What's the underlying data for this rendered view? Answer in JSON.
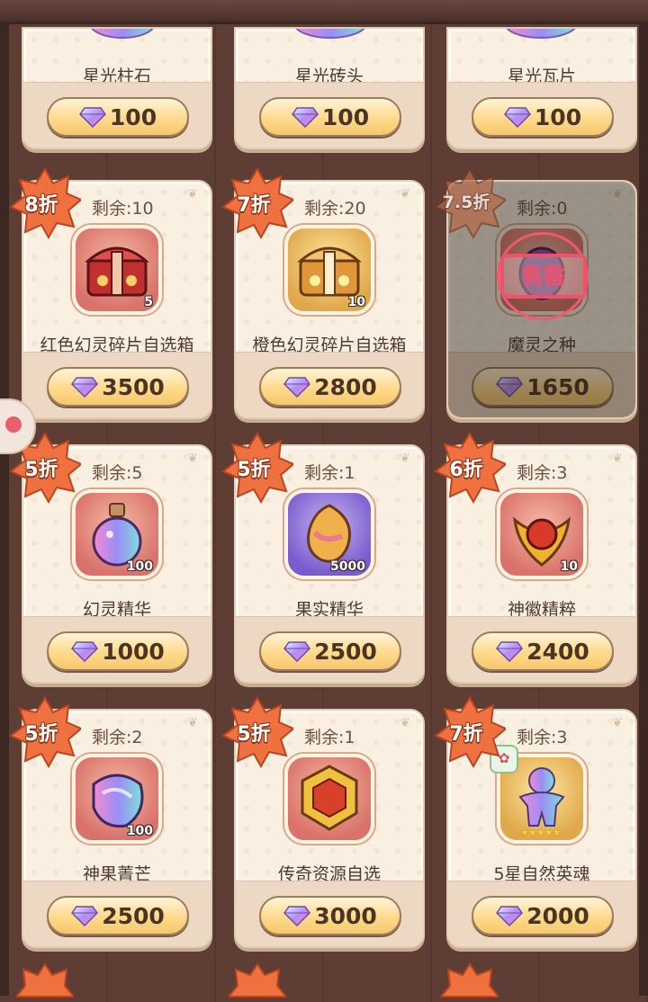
{
  "colors": {
    "badge": "#ef7140",
    "price_bg": "#ffd98c",
    "card_bg": "#faf0e2",
    "stamp": "#f0506a"
  },
  "top_row": [
    {
      "name": "星光柱石",
      "price": "100",
      "icon": "starlight-pillar-icon"
    },
    {
      "name": "星光砖头",
      "price": "100",
      "icon": "starlight-brick-icon"
    },
    {
      "name": "星光瓦片",
      "price": "100",
      "icon": "starlight-tile-icon"
    }
  ],
  "items": [
    {
      "discount": "8折",
      "remain": "剩余:10",
      "name": "红色幻灵碎片自选箱",
      "qty": "5",
      "price": "3500",
      "icon": "red-chest-icon"
    },
    {
      "discount": "7折",
      "remain": "剩余:20",
      "name": "橙色幻灵碎片自选箱",
      "qty": "10",
      "price": "2800",
      "icon": "orange-chest-icon"
    },
    {
      "discount": "7.5折",
      "remain": "剩余:0",
      "name": "魔灵之种",
      "qty": "",
      "price": "1650",
      "icon": "demon-seed-icon",
      "sold_out": true,
      "sold_out_label": "售罄"
    },
    {
      "discount": "5折",
      "remain": "剩余:5",
      "name": "幻灵精华",
      "qty": "100",
      "price": "1000",
      "icon": "potion-bottle-icon"
    },
    {
      "discount": "5折",
      "remain": "剩余:1",
      "name": "果实精华",
      "qty": "5000",
      "price": "2500",
      "icon": "fruit-seed-icon"
    },
    {
      "discount": "6折",
      "remain": "剩余:3",
      "name": "神徽精粹",
      "qty": "10",
      "price": "2400",
      "icon": "divine-emblem-icon"
    },
    {
      "discount": "5折",
      "remain": "剩余:2",
      "name": "神果菁芒",
      "qty": "100",
      "price": "2500",
      "icon": "divine-fruit-icon"
    },
    {
      "discount": "5折",
      "remain": "剩余:1",
      "name": "传奇资源自选",
      "qty": "",
      "price": "3000",
      "icon": "legendary-crest-icon"
    },
    {
      "discount": "7折",
      "remain": "剩余:3",
      "name": "5星自然英魂",
      "qty": "",
      "price": "2000",
      "icon": "nature-hero-soul-icon",
      "stars": "★★★★★"
    }
  ]
}
